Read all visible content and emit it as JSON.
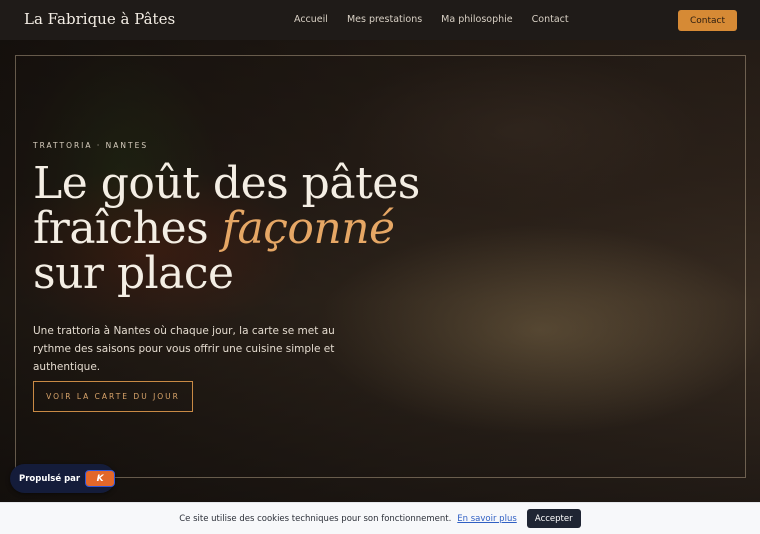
{
  "header": {
    "brand": "La Fabrique à Pâtes",
    "nav": [
      "Accueil",
      "Mes prestations",
      "Ma philosophie",
      "Contact"
    ],
    "cta_label": "Contact"
  },
  "hero": {
    "eyebrow": "TRATTORIA · NANTES",
    "headline_part1": "Le goût des pâtes fraîches ",
    "headline_accent": "façonné",
    "headline_part2": " sur place",
    "lead": "Une trattoria à Nantes où chaque jour, la carte se met au rythme des saisons pour vous offrir une cuisine simple et authentique.",
    "button_label": "VOIR LA CARTE DU JOUR"
  },
  "badge": {
    "label": "Propulsé par",
    "logo_text": "K"
  },
  "cookie": {
    "text": "Ce site utilise des cookies techniques pour son fonctionnement.",
    "link_label": "En savoir plus",
    "accept_label": "Accepter"
  },
  "colors": {
    "accent": "#d68a35",
    "headline_accent": "#e6a765",
    "navbar_bg": "#1f1b18",
    "badge_bg": "#141c3a",
    "cookie_button_bg": "#1f2533"
  }
}
